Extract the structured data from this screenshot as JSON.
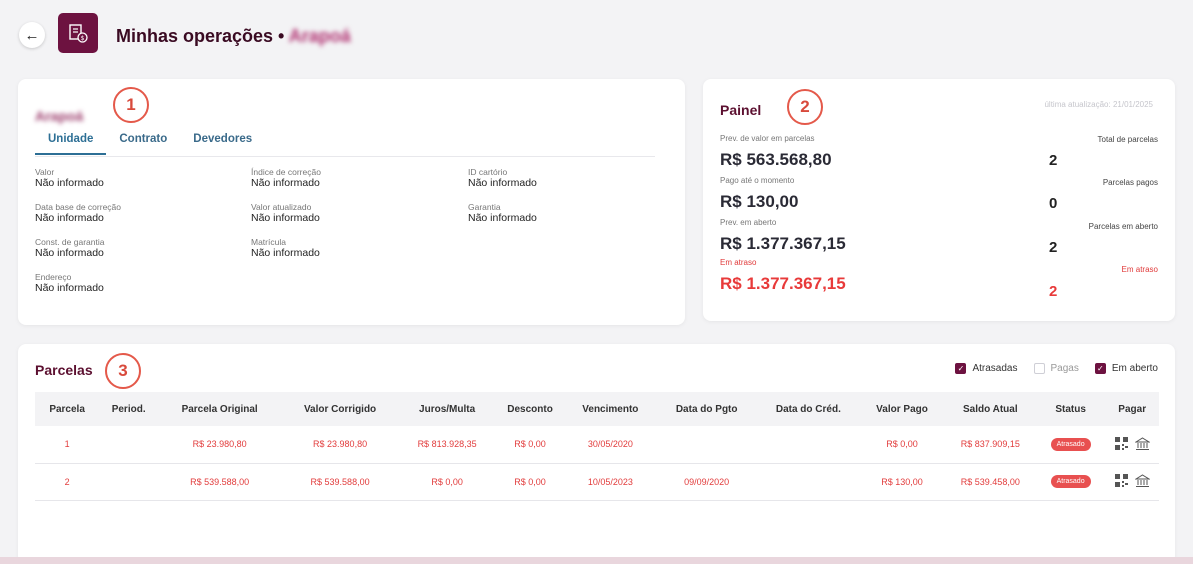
{
  "header": {
    "title": "Minhas operações •",
    "title_blurred": "Arapoá",
    "back_icon": "arrow-left-icon",
    "app_icon": "building-money-icon",
    "brand_color": "#6d1240"
  },
  "badges": [
    "1",
    "2",
    "3"
  ],
  "unit_card": {
    "name": "Arapoá",
    "tabs": [
      "Unidade",
      "Contrato",
      "Devedores"
    ],
    "active_tab": "Unidade",
    "fields": [
      {
        "label": "Valor",
        "value": "Não informado"
      },
      {
        "label": "Índice de correção",
        "value": "Não informado"
      },
      {
        "label": "ID cartório",
        "value": "Não informado"
      },
      {
        "label": "Data base de correção",
        "value": "Não informado"
      },
      {
        "label": "Valor atualizado",
        "value": "Não informado"
      },
      {
        "label": "Garantia",
        "value": "Não informado"
      },
      {
        "label": "Const. de garantia",
        "value": "Não informado"
      },
      {
        "label": "Matrícula",
        "value": "Não informado"
      },
      {
        "label": "Endereço",
        "value": "Não informado"
      }
    ]
  },
  "painel": {
    "title": "Painel",
    "updated": "última atualização: 21/01/2025",
    "left": [
      {
        "label": "Prev. de valor em parcelas",
        "value": "R$ 563.568,80"
      },
      {
        "label": "Pago até o momento",
        "value": "R$ 130,00"
      },
      {
        "label": "Prev. em aberto",
        "value": "R$ 1.377.367,15"
      },
      {
        "label": "Em atraso",
        "value": "R$ 1.377.367,15"
      }
    ],
    "right": [
      {
        "label": "Total de parcelas",
        "value": "2"
      },
      {
        "label": "Parcelas pagos",
        "value": "0"
      },
      {
        "label": "Parcelas em aberto",
        "value": "2"
      },
      {
        "label": "Em atraso",
        "value": "2"
      }
    ]
  },
  "parcelas": {
    "title": "Parcelas",
    "filters": [
      {
        "label": "Atrasadas",
        "checked": true
      },
      {
        "label": "Pagas",
        "checked": false
      },
      {
        "label": "Em aberto",
        "checked": true
      }
    ],
    "columns": [
      "Parcela",
      "Period.",
      "Parcela Original",
      "Valor Corrigido",
      "Juros/Multa",
      "Desconto",
      "Vencimento",
      "Data do Pgto",
      "Data do Créd.",
      "Valor Pago",
      "Saldo Atual",
      "Status",
      "Pagar"
    ],
    "rows": [
      {
        "parcela": "1",
        "period": "",
        "original": "R$ 23.980,80",
        "corrigido": "R$ 23.980,80",
        "juros": "R$ 813.928,35",
        "desconto": "R$ 0,00",
        "vencimento": "30/05/2020",
        "pgto": "",
        "cred": "",
        "pago": "R$ 0,00",
        "saldo": "R$ 837.909,15",
        "status": "Atrasado"
      },
      {
        "parcela": "2",
        "period": "",
        "original": "R$ 539.588,00",
        "corrigido": "R$ 539.588,00",
        "juros": "R$ 0,00",
        "desconto": "R$ 0,00",
        "vencimento": "10/05/2023",
        "pgto": "09/09/2020",
        "cred": "",
        "pago": "R$ 130,00",
        "saldo": "R$ 539.458,00",
        "status": "Atrasado"
      }
    ],
    "pay_icons": [
      "qr-code-icon",
      "bank-icon"
    ]
  }
}
